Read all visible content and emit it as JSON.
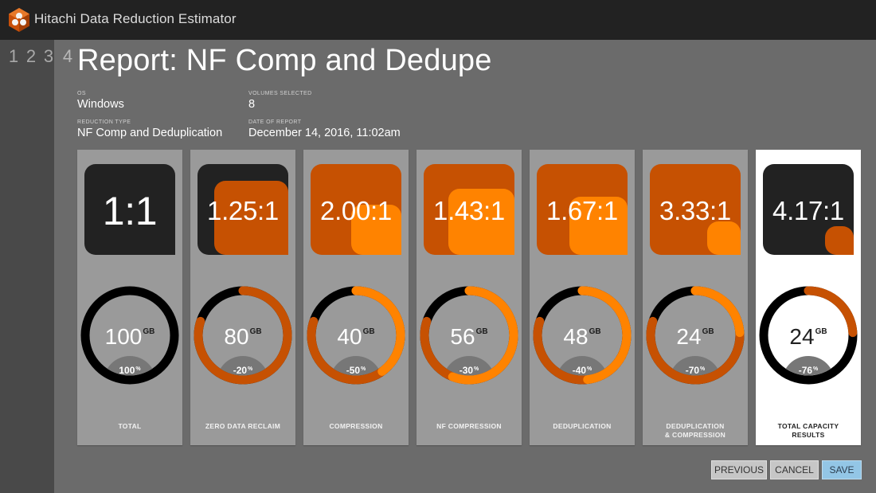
{
  "app": {
    "title": "Hitachi Data Reduction Estimator"
  },
  "steps": [
    {
      "label": "1",
      "current": false
    },
    {
      "label": "2",
      "current": false
    },
    {
      "label": "3",
      "current": false
    },
    {
      "label": "4",
      "current": true
    }
  ],
  "report": {
    "title": "Report: NF Comp and Dedupe",
    "os": {
      "label": "OS",
      "value": "Windows"
    },
    "volumes": {
      "label": "VOLUMES SELECTED",
      "value": "8"
    },
    "reduction_type": {
      "label": "REDUCTION TYPE",
      "value": "NF Comp and Deduplication"
    },
    "date": {
      "label": "DATE OF REPORT",
      "value": "December 14, 2016, 11:02am"
    }
  },
  "colors": {
    "dark": "#222222",
    "dark-orange": "#c65102",
    "bright-orange": "#ff8300",
    "ring-base": "#000000",
    "dome": "#777777",
    "save": "#93c6e6"
  },
  "cards": [
    {
      "id": "total",
      "label_lines": [
        "TOTAL"
      ],
      "ratio": "1:1",
      "big_ratio": true,
      "capacity": "100",
      "unit": "GB",
      "percent": "100",
      "percent_unit": "%",
      "highlight": false,
      "tile": {
        "outer": "dark",
        "inner": null,
        "inner_fraction": 0
      },
      "ring": []
    },
    {
      "id": "zero-data-reclaim",
      "label_lines": [
        "ZERO DATA RECLAIM"
      ],
      "ratio": "1.25:1",
      "capacity": "80",
      "unit": "GB",
      "percent": "-20",
      "percent_unit": "%",
      "highlight": false,
      "tile": {
        "outer": "dark",
        "inner": "dark-orange",
        "inner_fraction": 0.8
      },
      "ring": [
        {
          "color": "dark-orange",
          "fraction": 0.8
        }
      ]
    },
    {
      "id": "compression",
      "label_lines": [
        "COMPRESSION"
      ],
      "ratio": "2.00:1",
      "capacity": "40",
      "unit": "GB",
      "percent": "-50",
      "percent_unit": "%",
      "highlight": false,
      "tile": {
        "outer": "dark-orange",
        "inner": "bright-orange",
        "inner_fraction": 0.5
      },
      "ring": [
        {
          "color": "dark-orange",
          "fraction": 0.8
        },
        {
          "color": "bright-orange",
          "fraction": 0.4
        }
      ]
    },
    {
      "id": "nf-compression",
      "label_lines": [
        "NF COMPRESSION"
      ],
      "ratio": "1.43:1",
      "capacity": "56",
      "unit": "GB",
      "percent": "-30",
      "percent_unit": "%",
      "highlight": false,
      "tile": {
        "outer": "dark-orange",
        "inner": "bright-orange",
        "inner_fraction": 0.7
      },
      "ring": [
        {
          "color": "dark-orange",
          "fraction": 0.8
        },
        {
          "color": "bright-orange",
          "fraction": 0.56
        }
      ]
    },
    {
      "id": "deduplication",
      "label_lines": [
        "DEDUPLICATION"
      ],
      "ratio": "1.67:1",
      "capacity": "48",
      "unit": "GB",
      "percent": "-40",
      "percent_unit": "%",
      "highlight": false,
      "tile": {
        "outer": "dark-orange",
        "inner": "bright-orange",
        "inner_fraction": 0.6
      },
      "ring": [
        {
          "color": "dark-orange",
          "fraction": 0.8
        },
        {
          "color": "bright-orange",
          "fraction": 0.48
        }
      ]
    },
    {
      "id": "dedup-compression",
      "label_lines": [
        "DEDUPLICATION",
        "& COMPRESSION"
      ],
      "ratio": "3.33:1",
      "capacity": "24",
      "unit": "GB",
      "percent": "-70",
      "percent_unit": "%",
      "highlight": false,
      "tile": {
        "outer": "dark-orange",
        "inner": "bright-orange",
        "inner_fraction": 0.3
      },
      "ring": [
        {
          "color": "dark-orange",
          "fraction": 0.8
        },
        {
          "color": "bright-orange",
          "fraction": 0.24
        }
      ]
    },
    {
      "id": "total-capacity-results",
      "label_lines": [
        "TOTAL CAPACITY",
        "RESULTS"
      ],
      "ratio": "4.17:1",
      "capacity": "24",
      "unit": "GB",
      "percent": "-76",
      "percent_unit": "%",
      "highlight": true,
      "tile": {
        "outer": "dark",
        "inner": "dark-orange",
        "inner_fraction": 0.24
      },
      "ring": [
        {
          "color": "dark-orange",
          "fraction": 0.24
        }
      ]
    }
  ],
  "buttons": {
    "previous": "PREVIOUS",
    "cancel": "CANCEL",
    "save": "SAVE"
  }
}
